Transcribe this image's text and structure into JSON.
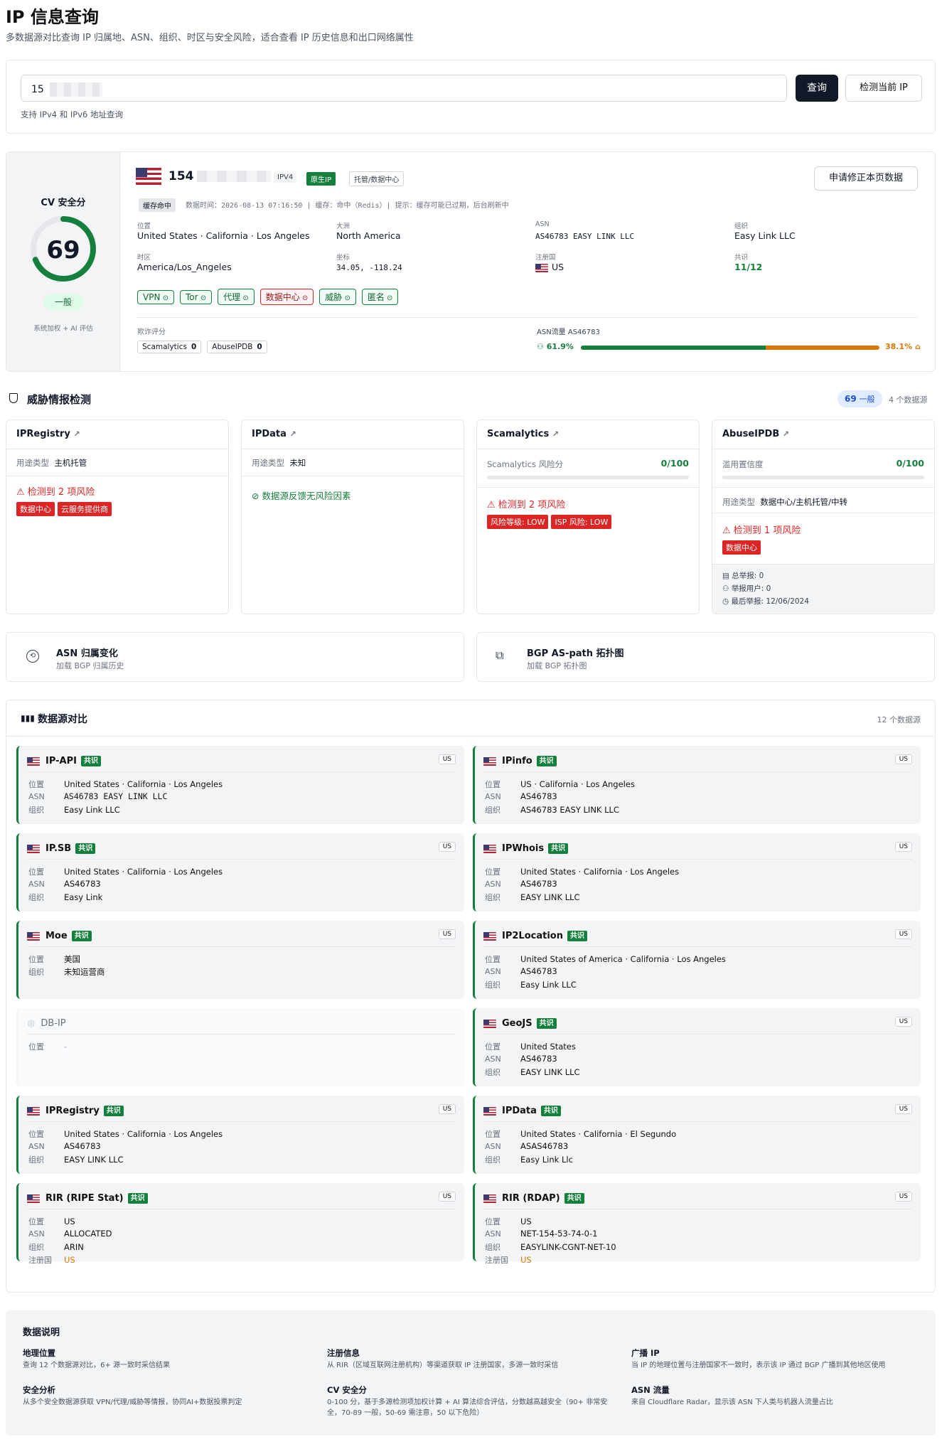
{
  "header": {
    "title": "IP 信息查询",
    "subtitle": "多数据源对比查询 IP 归属地、ASN、组织、时区与安全风险，适合查看 IP 历史信息和出口网络属性"
  },
  "search": {
    "value": "15",
    "query_button": "查询",
    "detect_button": "检测当前 IP",
    "hint": "支持 IPv4 和 IPv6 地址查询"
  },
  "score": {
    "label": "CV 安全分",
    "value": "69",
    "level": "一般",
    "note": "系统加权 + AI 评估",
    "percent": 69
  },
  "summary": {
    "ip": "154",
    "ip_version": "IPV4",
    "native_badge": "原生IP",
    "hosting_badge": "托管/数据中心",
    "correction_button": "申请修正本页数据",
    "cache_badge": "缓存命中",
    "meta": "数据时间：2026-08-13 07:16:50 | 缓存：命中（Redis）| 提示：缓存可能已过期，后台刷新中",
    "fields": [
      {
        "label": "位置",
        "value": "United States · California · Los Angeles"
      },
      {
        "label": "大洲",
        "value": "North America"
      },
      {
        "label": "ASN",
        "value": "AS46783 EASY LINK LLC"
      },
      {
        "label": "组织",
        "value": "Easy Link LLC"
      },
      {
        "label": "时区",
        "value": "America/Los_Angeles"
      },
      {
        "label": "坐标",
        "value": "34.05, -118.24"
      },
      {
        "label": "注册国",
        "value": "US"
      },
      {
        "label": "共识",
        "value": "11/12"
      }
    ],
    "tags": [
      {
        "label": "VPN",
        "risk": false
      },
      {
        "label": "Tor",
        "risk": false
      },
      {
        "label": "代理",
        "risk": false
      },
      {
        "label": "数据中心",
        "risk": true
      },
      {
        "label": "威胁",
        "risk": false
      },
      {
        "label": "匿名",
        "risk": false
      }
    ],
    "fraud_label": "欺诈评分",
    "fraud_sources": [
      {
        "name": "Scamalytics",
        "value": "0"
      },
      {
        "name": "AbuseIPDB",
        "value": "0"
      }
    ],
    "asn_traffic_label": "ASN流量 AS46783",
    "human_pct": "61.9%",
    "bot_pct": "38.1%",
    "human_fraction": 0.619
  },
  "threat": {
    "title": "威胁情报检测",
    "score_badge": "69",
    "score_level": "一般",
    "source_count": "4 个数据源",
    "sources": [
      {
        "name": "IPRegistry",
        "usage_label": "用途类型",
        "usage": "主机托管",
        "risk_text": "检测到 2 项风险",
        "tags": [
          "数据中心",
          "云服务提供商"
        ]
      },
      {
        "name": "IPData",
        "usage_label": "用途类型",
        "usage": "未知",
        "ok_text": "数据源反馈无风险因素"
      },
      {
        "name": "Scamalytics",
        "score_label": "Scamalytics 风险分",
        "score": "0/100",
        "risk_text": "检测到 2 项风险",
        "tags": [
          "风险等级: LOW",
          "ISP 风险: LOW"
        ]
      },
      {
        "name": "AbuseIPDB",
        "score_label": "滥用置信度",
        "score": "0/100",
        "usage_label": "用途类型",
        "usage": "数据中心/主机托管/中转",
        "risk_text": "检测到 1 项风险",
        "tags": [
          "数据中心"
        ],
        "stats": [
          "总举报: 0",
          "举报用户: 0",
          "最后举报: 12/06/2024"
        ]
      }
    ]
  },
  "asn_history": {
    "title": "ASN 归属变化",
    "subtitle": "加载 BGP 归属历史"
  },
  "bgp": {
    "title": "BGP AS-path 拓扑图",
    "subtitle": "加载 BGP 拓扑图"
  },
  "compare": {
    "title": "数据源对比",
    "count": "12 个数据源",
    "consensus": "共识",
    "us": "US",
    "labels": {
      "loc": "位置",
      "asn": "ASN",
      "org": "组织",
      "reg": "注册国"
    },
    "sources": [
      {
        "name": "IP-API",
        "loc": "United States · California · Los Angeles",
        "asn": "AS46783 EASY LINK LLC",
        "org": "Easy Link LLC",
        "mono": true
      },
      {
        "name": "IPinfo",
        "loc": "US · California · Los Angeles",
        "asn": "AS46783",
        "org": "AS46783 EASY LINK LLC"
      },
      {
        "name": "IP.SB",
        "loc": "United States · California · Los Angeles",
        "asn": "AS46783",
        "org": "Easy Link"
      },
      {
        "name": "IPWhois",
        "loc": "United States · California · Los Angeles",
        "asn": "AS46783",
        "org": "EASY LINK LLC"
      },
      {
        "name": "Moe",
        "loc": "美国",
        "org2": "未知运营商"
      },
      {
        "name": "IP2Location",
        "loc": "United States of America · California · Los Angeles",
        "asn": "AS46783",
        "org": "Easy Link LLC"
      },
      {
        "name": "DB-IP",
        "loc": "-",
        "disabled": true
      },
      {
        "name": "GeoJS",
        "loc": "United States",
        "asn": "AS46783",
        "org": "EASY LINK LLC"
      },
      {
        "name": "IPRegistry",
        "loc": "United States · California · Los Angeles",
        "asn": "AS46783",
        "org": "EASY LINK LLC"
      },
      {
        "name": "IPData",
        "loc": "United States · California · El Segundo",
        "asn": "ASAS46783",
        "org": "Easy Link Llc"
      },
      {
        "name": "RIR (RIPE Stat)",
        "loc": "US",
        "asn": "ALLOCATED",
        "org": "ARIN",
        "reg": "US"
      },
      {
        "name": "RIR (RDAP)",
        "loc": "US",
        "asn": "NET-154-53-74-0-1",
        "org": "EASYLINK-CGNT-NET-10",
        "reg": "US"
      }
    ]
  },
  "notes": {
    "title": "数据说明",
    "items": [
      {
        "title": "地理位置",
        "text": "查询 12 个数据源对比，6+ 源一致时采信结果"
      },
      {
        "title": "注册信息",
        "text": "从 RIR（区域互联网注册机构）等渠道获取 IP 注册国家，多源一致时采信"
      },
      {
        "title": "广播 IP",
        "text": "当 IP 的地理位置与注册国家不一致时，表示该 IP 通过 BGP 广播到其他地区使用"
      },
      {
        "title": "安全分析",
        "text": "从多个安全数据源获取 VPN/代理/威胁等情报，协同AI+数据投票判定"
      },
      {
        "title": "CV 安全分",
        "text": "0-100 分，基于多源检测项加权计算 + AI 算法综合评估，分数越高越安全（90+ 非常安全，70-89 一般，50-69 需注意，50 以下危险）"
      },
      {
        "title": "ASN 流量",
        "text": "来自 Cloudflare Radar，显示该 ASN 下人类与机器人流量占比"
      }
    ]
  }
}
